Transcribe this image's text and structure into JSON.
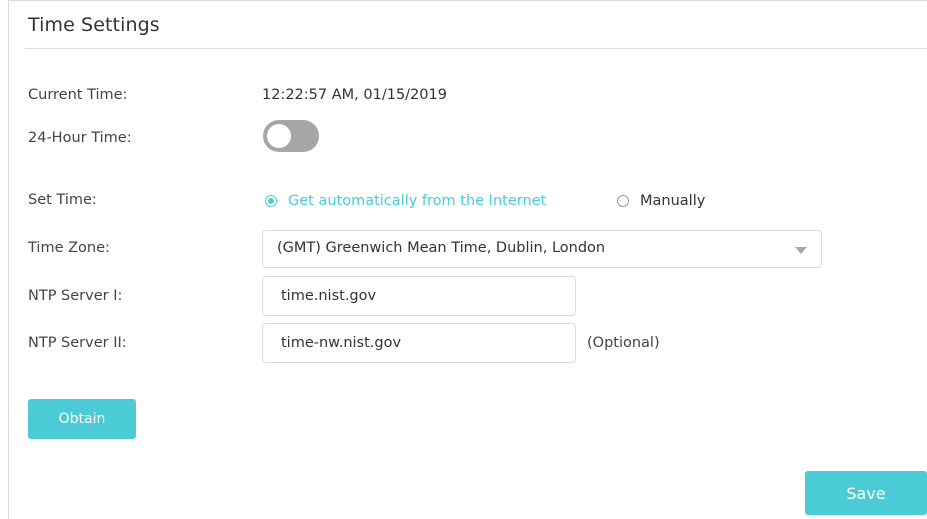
{
  "page": {
    "title": "Time Settings"
  },
  "fields": {
    "current_time": {
      "label": "Current Time:",
      "value": "12:22:57 AM, 01/15/2019"
    },
    "hour24": {
      "label": "24-Hour Time:",
      "enabled": false
    },
    "set_time": {
      "label": "Set Time:",
      "options": [
        {
          "label": "Get automatically from the Internet",
          "checked": true
        },
        {
          "label": "Manually",
          "checked": false
        }
      ]
    },
    "time_zone": {
      "label": "Time Zone:",
      "selected": "(GMT) Greenwich Mean Time, Dublin, London"
    },
    "ntp1": {
      "label": "NTP Server I:",
      "value": "time.nist.gov"
    },
    "ntp2": {
      "label": "NTP Server II:",
      "value": "time-nw.nist.gov",
      "note": "(Optional)"
    }
  },
  "buttons": {
    "obtain": "Obtain",
    "save": "Save"
  },
  "colors": {
    "accent": "#4acbd6",
    "toggle_off": "#a6a6a6",
    "border": "#dcdcdc",
    "text": "#333333"
  },
  "icons": {
    "dropdown": "chevron-down-icon",
    "radio_checked": "radio-checked-icon",
    "radio_unchecked": "radio-unchecked-icon"
  }
}
